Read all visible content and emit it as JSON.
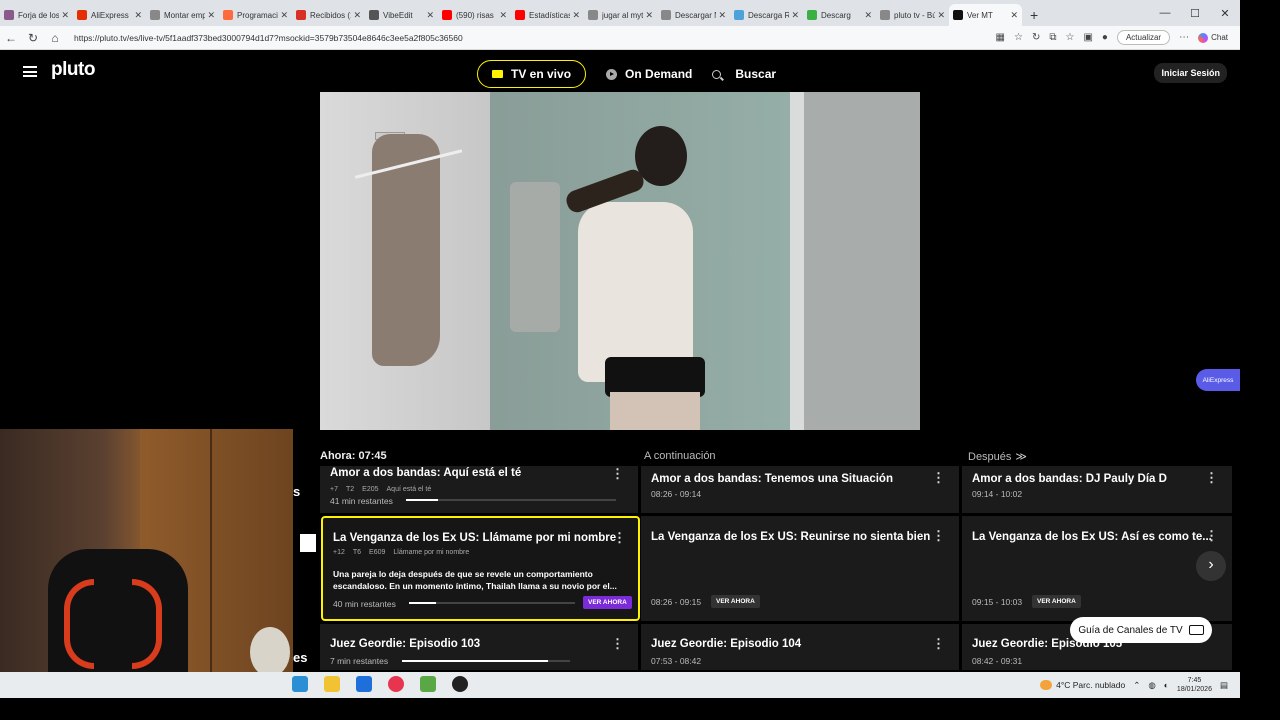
{
  "browser": {
    "tabs": [
      {
        "label": "Forja de los",
        "color": "#8a5a8a"
      },
      {
        "label": "AliExpress",
        "color": "#e62e04"
      },
      {
        "label": "Montar emp",
        "color": "#888888"
      },
      {
        "label": "Programaci",
        "color": "#ff6a3d"
      },
      {
        "label": "Recibidos (1",
        "color": "#d93025"
      },
      {
        "label": "VibeEdit",
        "color": "#555555"
      },
      {
        "label": "(590) risas",
        "color": "#ff0000"
      },
      {
        "label": "Estadísticas",
        "color": "#ff0000"
      },
      {
        "label": "jugar al myt",
        "color": "#888888"
      },
      {
        "label": "Descargar N",
        "color": "#888888"
      },
      {
        "label": "Descarga Ri",
        "color": "#4da3d9"
      },
      {
        "label": "Descarg",
        "color": "#3cb043"
      },
      {
        "label": "pluto tv - Bú",
        "color": "#888888"
      },
      {
        "label": "Ver MT",
        "color": "#111111"
      }
    ],
    "url": "https://pluto.tv/es/live-tv/5f1aadf373bed3000794d1d7?msockid=3579b73504e8646c3ee5a2f805c36560",
    "update_label": "Actualizar",
    "chat_label": "Chat"
  },
  "header": {
    "logo": "pluto",
    "nav_tv": "TV en vivo",
    "nav_on_demand": "On Demand",
    "nav_search": "Buscar",
    "signin": "Iniciar Sesión"
  },
  "guide": {
    "now_label": "Ahora: 07:45",
    "next_label": "A continuación",
    "after_label": "Después",
    "rows": [
      {
        "now": {
          "title": "Amor a dos bandas: Aquí está el té",
          "rating": "+7",
          "season": "T2",
          "episode": "E205",
          "episode_title": "Aquí está el té",
          "remaining": "41 min restantes",
          "progress": 0.15
        },
        "next": {
          "title": "Amor a dos bandas: Tenemos una Situación",
          "time": "08:26 - 09:14"
        },
        "after": {
          "title": "Amor a dos bandas: DJ Pauly Día D",
          "time": "09:14 - 10:02"
        }
      },
      {
        "now": {
          "title": "La Venganza de los Ex US: Llámame por mi nombre",
          "rating": "+12",
          "season": "T6",
          "episode": "E609",
          "episode_title": "Llámame por mi nombre",
          "description": "Una pareja lo deja después de que se revele un comportamiento escandaloso. En un momento íntimo, Thailah llama a su novio por el...",
          "remaining": "40 min restantes",
          "progress": 0.16,
          "cta": "VER AHORA"
        },
        "next": {
          "title": "La Venganza de los Ex US: Reunirse no sienta bien",
          "time": "08:26 - 09:15",
          "cta": "VER AHORA"
        },
        "after": {
          "title": "La Venganza de los Ex US: Así es como te...",
          "time": "09:15 - 10:03",
          "cta": "VER AHORA"
        }
      },
      {
        "now": {
          "title": "Juez Geordie: Episodio 103",
          "remaining": "7 min restantes",
          "progress": 0.87
        },
        "next": {
          "title": "Juez Geordie: Episodio 104",
          "time": "07:53 - 08:42"
        },
        "after": {
          "title": "Juez Geordie: Episodio 105",
          "time": "08:42 - 09:31"
        }
      }
    ],
    "channel_guide": "Guía de Canales de TV",
    "aliexpress_badge": "AliExpress"
  },
  "taskbar": {
    "weather": "4°C  Parc. nublado",
    "time": "7:45",
    "date": "18/01/2026"
  }
}
